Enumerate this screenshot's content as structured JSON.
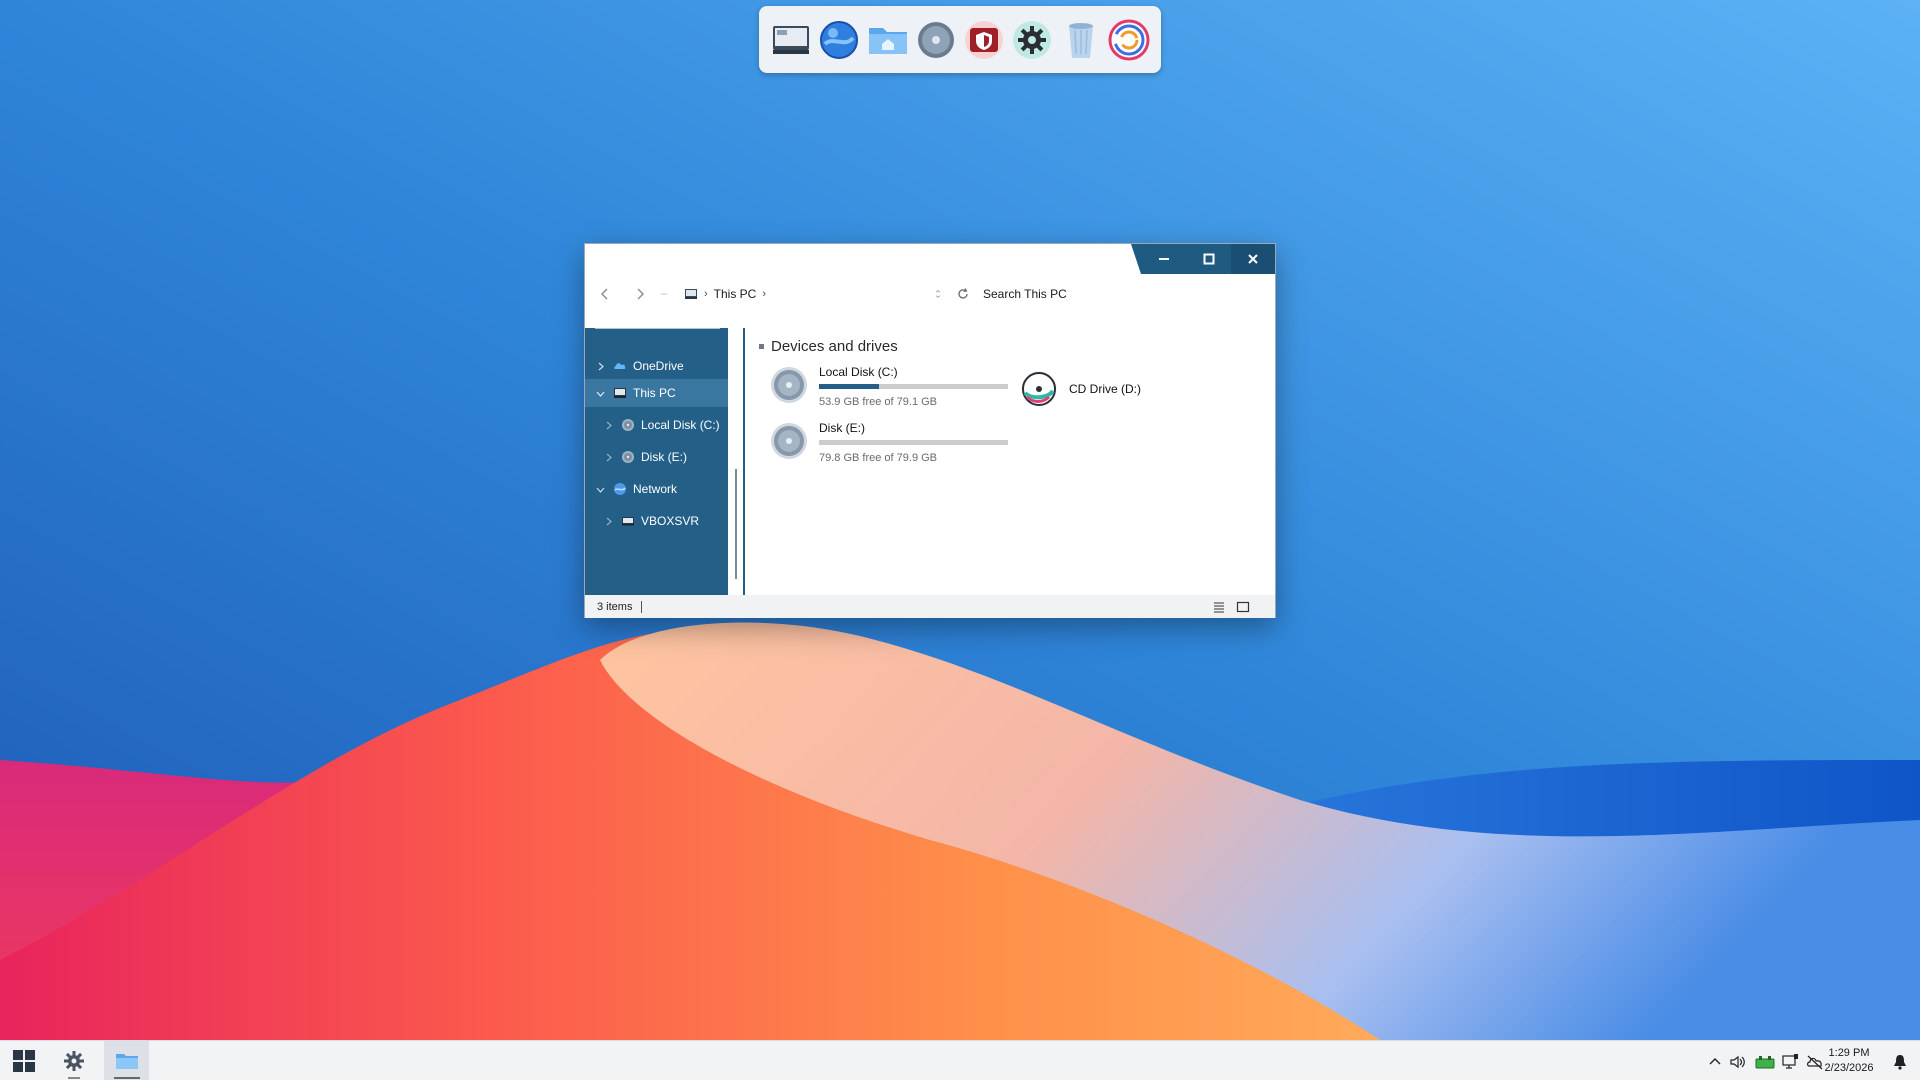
{
  "dock": {
    "items": [
      {
        "icon": "this-pc-icon"
      },
      {
        "icon": "browser-globe-icon"
      },
      {
        "icon": "file-explorer-folder-icon"
      },
      {
        "icon": "disk-icon"
      },
      {
        "icon": "security-shield-icon"
      },
      {
        "icon": "settings-gear-icon"
      },
      {
        "icon": "recycle-bin-icon"
      },
      {
        "icon": "swirl-app-icon"
      }
    ]
  },
  "explorer": {
    "breadcrumb": {
      "location": "This PC"
    },
    "search": {
      "placeholder": "Search This PC"
    },
    "sidebar": {
      "items": [
        {
          "label": "OneDrive",
          "icon": "onedrive-cloud-icon"
        },
        {
          "label": "This PC",
          "icon": "this-pc-icon"
        },
        {
          "label": "Local Disk (C:)",
          "icon": "disk-icon"
        },
        {
          "label": "Disk (E:)",
          "icon": "disk-icon"
        },
        {
          "label": "Network",
          "icon": "network-globe-icon"
        },
        {
          "label": "VBOXSVR",
          "icon": "network-computer-icon"
        }
      ]
    },
    "section": {
      "title": "Devices and drives"
    },
    "drives": [
      {
        "name": "Local Disk (C:)",
        "free_text": "53.9 GB free of 79.1 GB",
        "used_fraction": 0.32
      },
      {
        "name": "Disk (E:)",
        "free_text": "79.8 GB free of 79.9 GB",
        "used_fraction": 0.0
      },
      {
        "name": "CD Drive (D:)"
      }
    ],
    "status": {
      "items": "3 items"
    }
  },
  "tray": {
    "time": "1:29 PM",
    "date": "2/23/2026"
  },
  "colors": {
    "accent": "#245f88",
    "selection": "#3a77a0",
    "caption": "#1f5a80"
  }
}
